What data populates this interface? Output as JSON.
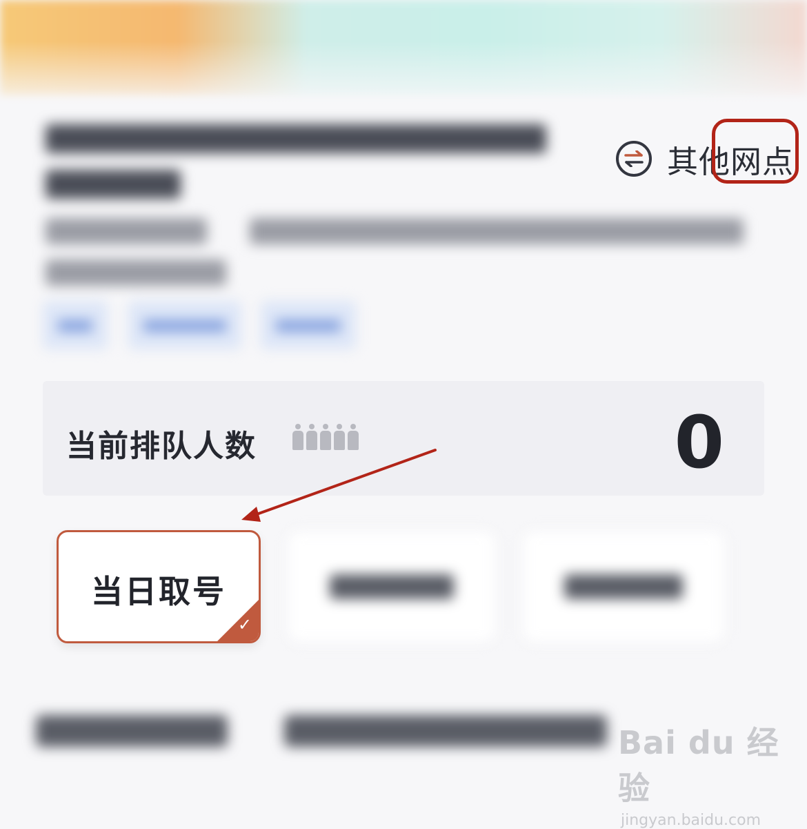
{
  "header": {
    "switch_branch_label": "其他网点"
  },
  "queue": {
    "label": "当前排队人数",
    "count": "0"
  },
  "options": [
    {
      "label": "当日取号",
      "selected": true
    }
  ],
  "watermark": {
    "logo_text": "Bai du 经验",
    "url": "jingyan.baidu.com"
  },
  "colors": {
    "accent": "#c05a3e",
    "annotation_red": "#b22418"
  }
}
